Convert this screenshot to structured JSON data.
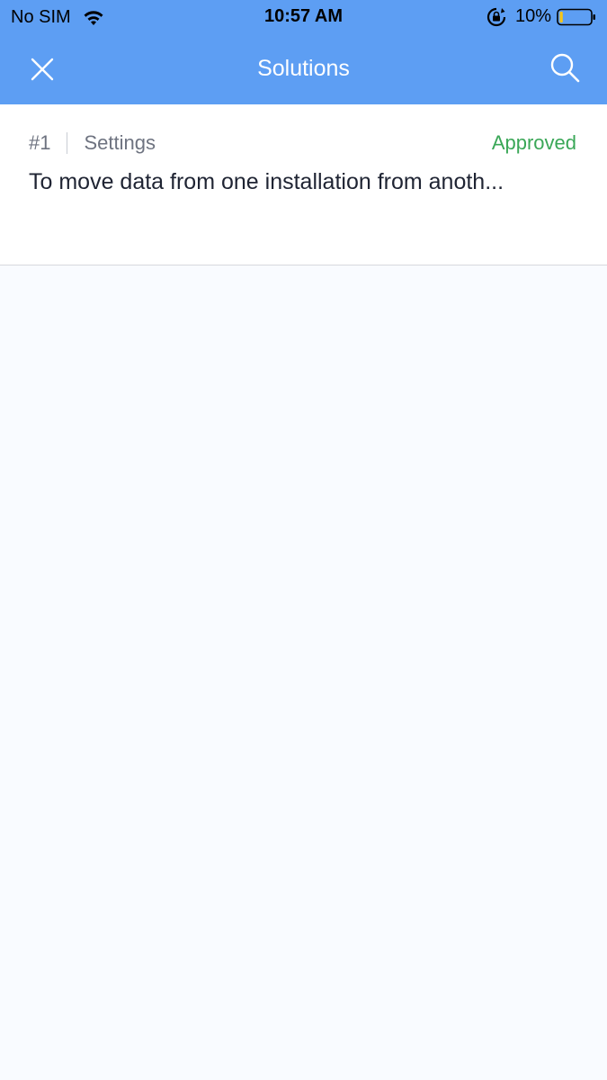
{
  "status_bar": {
    "carrier": "No SIM",
    "time": "10:57 AM",
    "battery_percent": "10%",
    "battery_level": 0.1,
    "battery_color": "#f5c518"
  },
  "nav": {
    "title": "Solutions",
    "close_icon": "close-icon",
    "search_icon": "search-icon"
  },
  "colors": {
    "header_bg": "#5d9ef3",
    "approved": "#3aa757"
  },
  "solutions": [
    {
      "number": "#1",
      "category": "Settings",
      "status": "Approved",
      "title": "To move data from one installation from anoth..."
    }
  ]
}
